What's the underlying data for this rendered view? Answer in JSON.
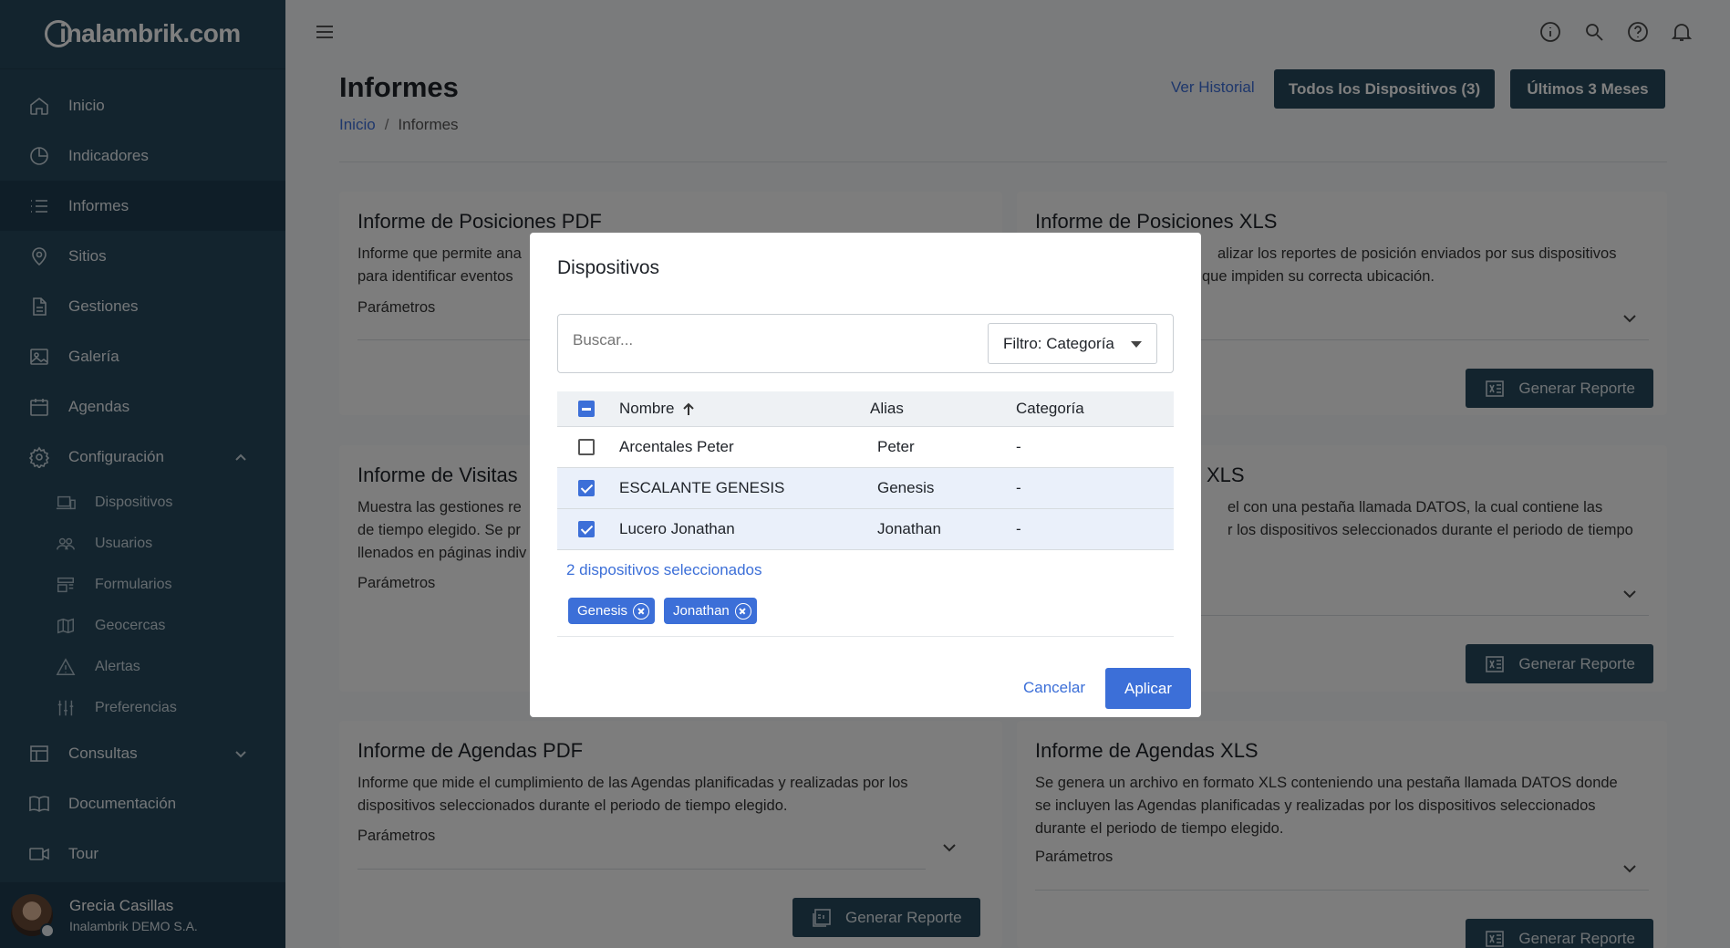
{
  "logo": {
    "text": "nalambrik.com",
    "letter": "i"
  },
  "sidebar": {
    "items": [
      {
        "label": "Inicio",
        "icon": "home-icon"
      },
      {
        "label": "Indicadores",
        "icon": "pie-chart-icon"
      },
      {
        "label": "Informes",
        "icon": "list-icon"
      },
      {
        "label": "Sitios",
        "icon": "map-pin-icon"
      },
      {
        "label": "Gestiones",
        "icon": "document-icon"
      },
      {
        "label": "Galería",
        "icon": "image-icon"
      },
      {
        "label": "Agendas",
        "icon": "calendar-icon"
      },
      {
        "label": "Configuración",
        "icon": "gear-icon"
      }
    ],
    "sub_items": [
      {
        "label": "Dispositivos",
        "icon": "devices-icon"
      },
      {
        "label": "Usuarios",
        "icon": "users-icon"
      },
      {
        "label": "Formularios",
        "icon": "forms-icon"
      },
      {
        "label": "Geocercas",
        "icon": "map-icon"
      },
      {
        "label": "Alertas",
        "icon": "warning-icon"
      },
      {
        "label": "Preferencias",
        "icon": "sliders-icon"
      }
    ],
    "bottom_items": [
      {
        "label": "Consultas",
        "icon": "table-icon"
      },
      {
        "label": "Documentación",
        "icon": "book-icon"
      },
      {
        "label": "Tour",
        "icon": "video-icon"
      }
    ],
    "user": {
      "name": "Grecia Casillas",
      "company": "Inalambrik DEMO S.A."
    }
  },
  "header": {
    "title": "Informes",
    "breadcrumb": {
      "home": "Inicio",
      "current": "Informes",
      "separator": "/"
    },
    "ver_historial": "Ver Historial",
    "devices_button": "Todos los Dispositivos (3)",
    "period_button": "Últimos 3 Meses"
  },
  "cards": [
    {
      "title": "Informe de Posiciones PDF",
      "desc1": "Informe que permite ana",
      "desc2": "para identificar eventos",
      "param": "Parámetros"
    },
    {
      "title": "Informe de Posiciones XLS",
      "desc1": "alizar los reportes de posición enviados por sus dispositivos",
      "desc2": "que impiden su correcta ubicación.",
      "button": "Generar Reporte"
    },
    {
      "title": "Informe de Visitas",
      "desc1": "Muestra las gestiones re",
      "desc2": "de tiempo elegido. Se pr",
      "desc3": "llenados en páginas indiv",
      "param": "Parámetros"
    },
    {
      "title": "XLS",
      "desc1": "el con una pestaña llamada DATOS, la cual contiene las",
      "desc2": "r los dispositivos seleccionados durante el periodo de tiempo",
      "button": "Generar Reporte"
    },
    {
      "title": "Informe de Agendas PDF",
      "desc1": "Informe que mide el cumplimiento de las Agendas planificadas y realizadas por los",
      "desc2": "dispositivos seleccionados durante el periodo de tiempo elegido.",
      "param": "Parámetros",
      "button": "Generar Reporte"
    },
    {
      "title": "Informe de Agendas XLS",
      "desc1": "Se genera un archivo en formato XLS conteniendo una pestaña llamada DATOS donde",
      "desc2": "se incluyen las Agendas planificadas y realizadas por los dispositivos seleccionados",
      "desc3": "durante el periodo de tiempo elegido.",
      "param": "Parámetros",
      "button": "Generar Reporte"
    }
  ],
  "modal": {
    "title": "Dispositivos",
    "search_placeholder": "Buscar...",
    "filter_label": "Filtro: Categoría",
    "columns": {
      "name": "Nombre",
      "alias": "Alias",
      "category": "Categoría"
    },
    "rows": [
      {
        "name": "Arcentales Peter",
        "alias": "Peter",
        "category": "-",
        "checked": false
      },
      {
        "name": "ESCALANTE GENESIS",
        "alias": "Genesis",
        "category": "-",
        "checked": true
      },
      {
        "name": "Lucero Jonathan",
        "alias": "Jonathan",
        "category": "-",
        "checked": true
      }
    ],
    "selected_count": "2 dispositivos seleccionados",
    "chips": [
      "Genesis",
      "Jonathan"
    ],
    "cancel": "Cancelar",
    "apply": "Aplicar"
  },
  "colors": {
    "sidebar": "#27485c",
    "accent": "#3c6fd8"
  }
}
